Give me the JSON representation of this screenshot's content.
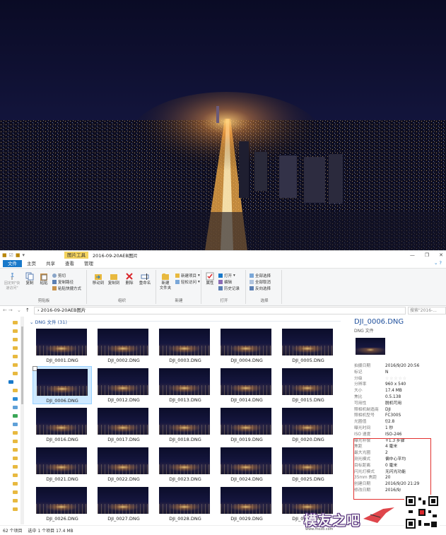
{
  "window": {
    "context_tab": "图片工具",
    "title": "2016-09-20AEB图片",
    "controls": [
      "—",
      "❐",
      "✕"
    ]
  },
  "tabs": [
    "文件",
    "主页",
    "共享",
    "查看",
    "管理"
  ],
  "ribbon": {
    "clipboard": {
      "pin": "固定到\"快速访问\"",
      "copy": "复制",
      "paste": "粘贴",
      "cut": "剪切",
      "copy_path": "复制路径",
      "paste_shortcut": "粘贴快捷方式",
      "label": "剪贴板"
    },
    "organize": {
      "move_to": "移动到",
      "copy_to": "复制到",
      "delete": "删除",
      "rename": "重命名",
      "label": "组织"
    },
    "new": {
      "new_folder": "新建\n文件夹",
      "new_item": "新建项目",
      "easy_access": "轻松访问",
      "label": "新建"
    },
    "open": {
      "properties": "属性",
      "open": "打开",
      "edit": "编辑",
      "history": "历史记录",
      "label": "打开"
    },
    "select": {
      "select_all": "全部选择",
      "select_none": "全部取消",
      "invert": "反向选择",
      "label": "选择"
    }
  },
  "address": {
    "path": "2016-09-20AEB图片",
    "search_placeholder": "搜索\"2016-..."
  },
  "files": {
    "group_header": "DNG 文件 (31)",
    "items": [
      "DJI_0001.DNG",
      "DJI_0002.DNG",
      "DJI_0003.DNG",
      "DJI_0004.DNG",
      "DJI_0005.DNG",
      "DJI_0006.DNG",
      "DJI_0012.DNG",
      "DJI_0013.DNG",
      "DJI_0014.DNG",
      "DJI_0015.DNG",
      "DJI_0016.DNG",
      "DJI_0017.DNG",
      "DJI_0018.DNG",
      "DJI_0019.DNG",
      "DJI_0020.DNG",
      "DJI_0021.DNG",
      "DJI_0022.DNG",
      "DJI_0023.DNG",
      "DJI_0024.DNG",
      "DJI_0025.DNG",
      "DJI_0026.DNG",
      "DJI_0027.DNG",
      "DJI_0028.DNG",
      "DJI_0029.DNG",
      "DJI_0030.DNG"
    ],
    "selected_index": 5
  },
  "details": {
    "name": "DJI_0006.DNG",
    "type": "DNG 文件",
    "properties": [
      {
        "k": "拍摄日期",
        "v": "2016/9/20 20:56"
      },
      {
        "k": "标记",
        "v": "N"
      },
      {
        "k": "分级",
        "v": "☆☆☆☆☆"
      },
      {
        "k": "分辨率",
        "v": "960 x 540"
      },
      {
        "k": "大小",
        "v": "17.4 MB"
      },
      {
        "k": "焦比",
        "v": "0.5.138"
      },
      {
        "k": "可用性",
        "v": "脱机可用"
      },
      {
        "k": "照相机制造商",
        "v": "DJI"
      },
      {
        "k": "照相机型号",
        "v": "FC300S"
      },
      {
        "k": "光圈值",
        "v": "f/2.8"
      },
      {
        "k": "曝光时间",
        "v": "1 秒"
      },
      {
        "k": "ISO 速度",
        "v": "ISO-246"
      },
      {
        "k": "曝光补偿",
        "v": "+1.3 步骤"
      },
      {
        "k": "焦距",
        "v": "4 毫米"
      },
      {
        "k": "最大光圈",
        "v": "2"
      },
      {
        "k": "测光模式",
        "v": "偏中心平均"
      },
      {
        "k": "目标距离",
        "v": "0 毫米"
      },
      {
        "k": "闪光灯模式",
        "v": "无闪光功能"
      },
      {
        "k": "35mm 焦距",
        "v": "20"
      },
      {
        "k": "创建日期",
        "v": "2016/9/20 21:29"
      },
      {
        "k": "修改日期",
        "v": "2016/9/"
      }
    ]
  },
  "status": {
    "count": "62 个项目",
    "selection": "选中 1 个项目  17.4 MB"
  },
  "watermark": {
    "text": "模友之吧",
    "url": "www.moz8.com"
  }
}
